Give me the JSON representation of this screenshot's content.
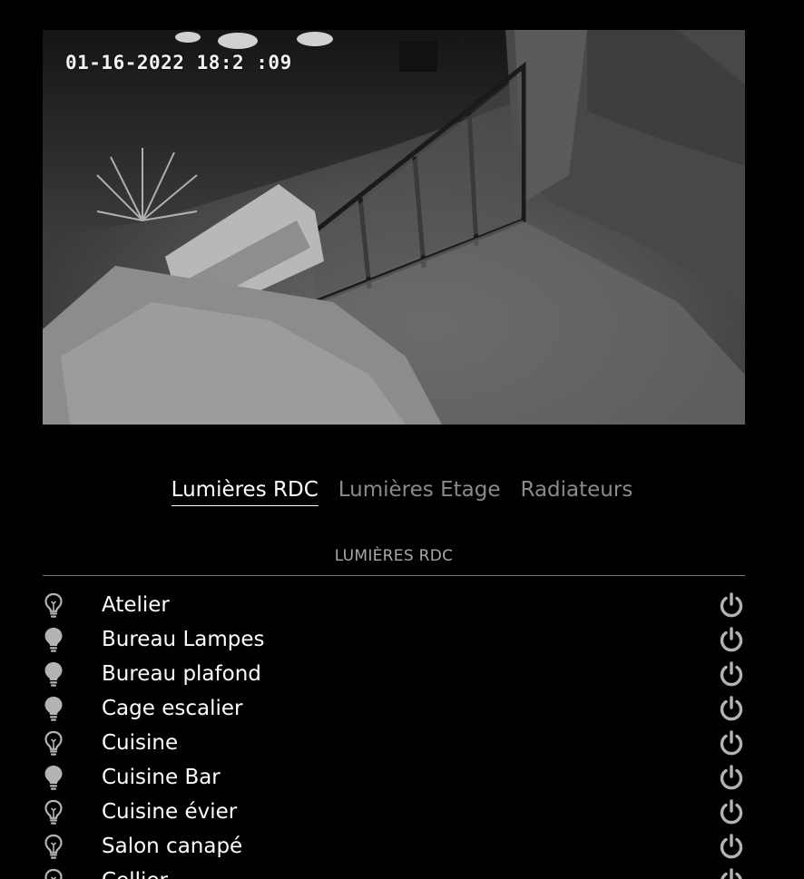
{
  "camera": {
    "timestamp": "01-16-2022 18:2 :09"
  },
  "tabs": [
    {
      "label": "Lumières RDC",
      "active": true
    },
    {
      "label": "Lumières Etage",
      "active": false
    },
    {
      "label": "Radiateurs",
      "active": false
    }
  ],
  "section": {
    "title": "LUMIÈRES RDC"
  },
  "devices": [
    {
      "name": "Atelier",
      "icon": "lightbulb-outline-icon",
      "state": "off"
    },
    {
      "name": "Bureau Lampes",
      "icon": "lightbulb-icon",
      "state": "on"
    },
    {
      "name": "Bureau plafond",
      "icon": "lightbulb-icon",
      "state": "on"
    },
    {
      "name": "Cage escalier",
      "icon": "lightbulb-icon",
      "state": "on"
    },
    {
      "name": "Cuisine",
      "icon": "lightbulb-outline-icon",
      "state": "off"
    },
    {
      "name": "Cuisine Bar",
      "icon": "lightbulb-icon",
      "state": "on"
    },
    {
      "name": "Cuisine évier",
      "icon": "lightbulb-outline-icon",
      "state": "off"
    },
    {
      "name": "Salon canapé",
      "icon": "lightbulb-outline-icon",
      "state": "off"
    },
    {
      "name": "Cellier",
      "icon": "lightbulb-outline-icon",
      "state": "off"
    }
  ],
  "colors": {
    "background": "#000000",
    "icon_gray": "#b3b3b3",
    "tab_inactive": "#8a8a8a",
    "text": "#ffffff"
  }
}
